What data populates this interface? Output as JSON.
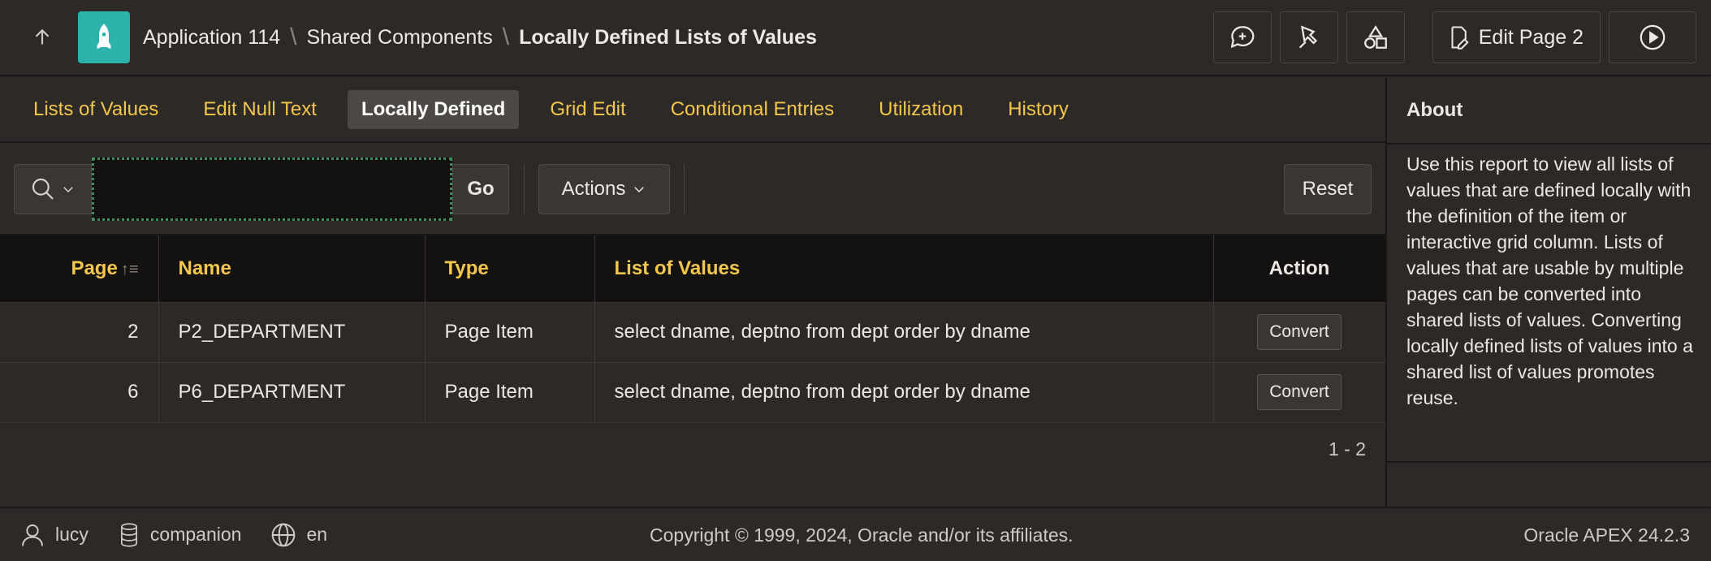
{
  "header": {
    "up_icon": "arrow-up-icon",
    "app_icon": "rocket-icon",
    "app_color": "#2bb3ab",
    "breadcrumbs": [
      "Application 114",
      "Shared Components",
      "Locally Defined Lists of Values"
    ],
    "edit_label": "Edit Page 2"
  },
  "tabs": [
    "Lists of Values",
    "Edit Null Text",
    "Locally Defined",
    "Grid Edit",
    "Conditional Entries",
    "Utilization",
    "History"
  ],
  "toolbar": {
    "search_value": "",
    "go_label": "Go",
    "actions_label": "Actions",
    "reset_label": "Reset"
  },
  "table": {
    "columns": [
      "Page",
      "Name",
      "Type",
      "List of Values",
      "Action"
    ],
    "rows": [
      {
        "page": "2",
        "name": "P2_DEPARTMENT",
        "type": "Page Item",
        "lov": "select dname, deptno from dept order by dname",
        "action": "Convert"
      },
      {
        "page": "6",
        "name": "P6_DEPARTMENT",
        "type": "Page Item",
        "lov": "select dname, deptno from dept order by dname",
        "action": "Convert"
      }
    ],
    "pagination": "1 - 2"
  },
  "side": {
    "title": "About",
    "text": "Use this report to view all lists of values that are defined locally with the definition of the item or interactive grid column. Lists of values that are usable by multiple pages can be converted into shared lists of values. Converting locally defined lists of values into a shared list of values promotes reuse."
  },
  "footer": {
    "user": "lucy",
    "schema": "companion",
    "language": "en",
    "copyright": "Copyright © 1999, 2024, Oracle and/or its affiliates.",
    "version": "Oracle APEX 24.2.3"
  },
  "colors": {
    "accent": "#f3c64c",
    "background": "#2c2926",
    "header_row": "#141211"
  }
}
